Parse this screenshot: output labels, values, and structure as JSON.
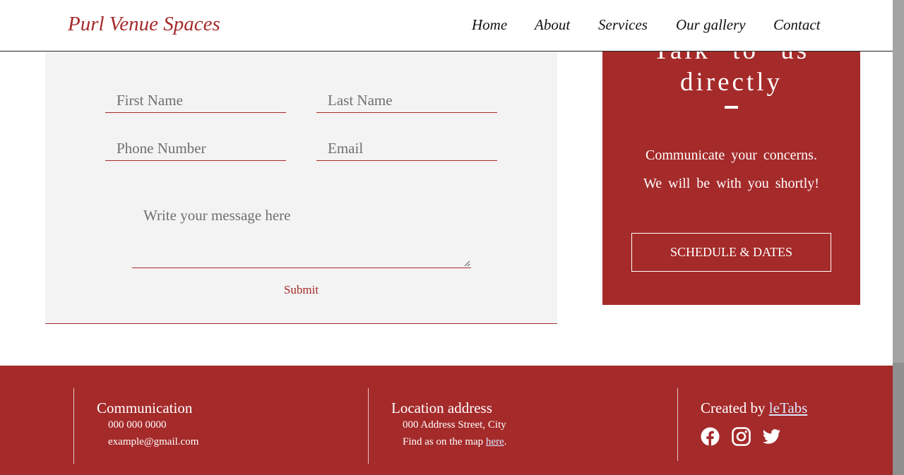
{
  "header": {
    "brand": "Purl Venue Spaces",
    "nav": [
      "Home",
      "About",
      "Services",
      "Our gallery",
      "Contact"
    ]
  },
  "form": {
    "first_name_placeholder": "First Name",
    "last_name_placeholder": "Last Name",
    "phone_placeholder": "Phone Number",
    "email_placeholder": "Email",
    "message_placeholder": "Write your message here",
    "submit_label": "Submit"
  },
  "talk": {
    "title": "Talk to us directly",
    "line1": "Communicate your concerns.",
    "line2": "We will be with you shortly!",
    "button_label": "SCHEDULE & DATES"
  },
  "footer": {
    "communication": {
      "title": "Communication",
      "phone": "000 000 0000",
      "email": "example@gmail.com"
    },
    "location": {
      "title": "Location address",
      "address": "000 Address Street, City",
      "map_prefix": "Find as on the map ",
      "map_link": "here",
      "map_suffix": "."
    },
    "credit": {
      "prefix": "Created by ",
      "link": "leTabs",
      "icons": [
        "facebook-icon",
        "instagram-icon",
        "twitter-icon"
      ]
    }
  },
  "colors": {
    "accent": "#a52a2a",
    "panel": "#f3f3f3",
    "link": "#d8e6ff"
  }
}
